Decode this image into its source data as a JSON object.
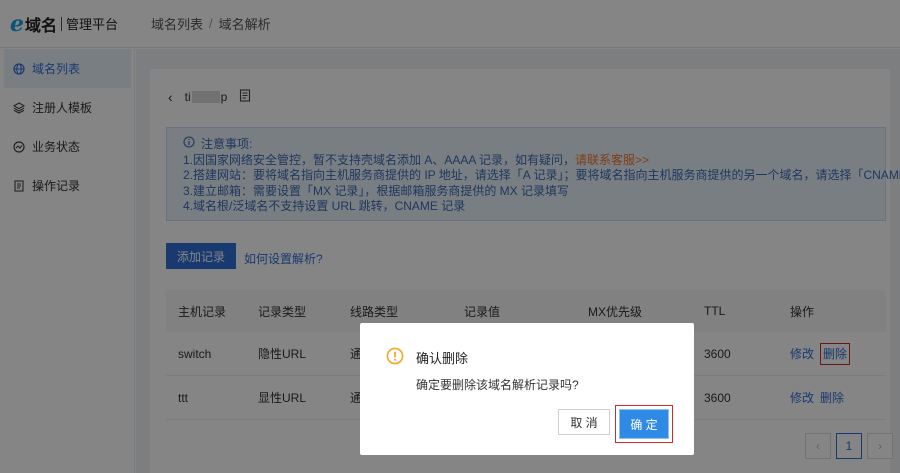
{
  "brand": {
    "logo_letter": "e",
    "name": "域名",
    "subtitle": "管理平台"
  },
  "breadcrumb": {
    "parent": "域名列表",
    "separator": "/",
    "current": "域名解析"
  },
  "sidebar": {
    "items": [
      {
        "label": "域名列表",
        "icon": "globe-icon",
        "active": true
      },
      {
        "label": "注册人模板",
        "icon": "layers-icon",
        "active": false
      },
      {
        "label": "业务状态",
        "icon": "gauge-icon",
        "active": false
      },
      {
        "label": "操作记录",
        "icon": "document-icon",
        "active": false
      }
    ]
  },
  "domain": {
    "prefix": "ti",
    "suffix": "p"
  },
  "notice": {
    "title": "注意事项:",
    "line1_text": "1.因国家网络安全管控，暂不支持壳域名添加 A、AAAA 记录，如有疑问，",
    "line1_link": "请联系客服>>",
    "line2": "2.搭建网站：要将域名指向主机服务商提供的 IP 地址，请选择「A 记录」；要将域名指向主机服务商提供的另一个域名，请选择「CNAME」",
    "line3": "3.建立邮箱：需要设置「MX 记录」，根据邮箱服务商提供的 MX 记录填写",
    "line4": "4.域名根/泛域名不支持设置 URL 跳转，CNAME 记录"
  },
  "actions": {
    "add_label": "添加记录",
    "help_link": "如何设置解析?"
  },
  "table": {
    "headers": [
      "主机记录",
      "记录类型",
      "线路类型",
      "记录值",
      "MX优先级",
      "TTL",
      "操作"
    ],
    "rows": [
      {
        "host": "switch",
        "type": "隐性URL",
        "line": "通",
        "ttl": "3600",
        "edit": "修改",
        "delete": "删除"
      },
      {
        "host": "ttt",
        "type": "显性URL",
        "line": "通",
        "ttl": "3600",
        "edit": "修改",
        "delete": "删除"
      }
    ]
  },
  "pagination": {
    "prev": "‹",
    "current": "1",
    "next": "›"
  },
  "dialog": {
    "title": "确认删除",
    "message": "确定要删除该域名解析记录吗?",
    "cancel_label": "取 消",
    "ok_label": "确 定"
  },
  "colors": {
    "primary": "#2f6fd6",
    "warning": "#f5a623",
    "highlight": "#d02b2b",
    "link_orange": "#f5732a"
  }
}
